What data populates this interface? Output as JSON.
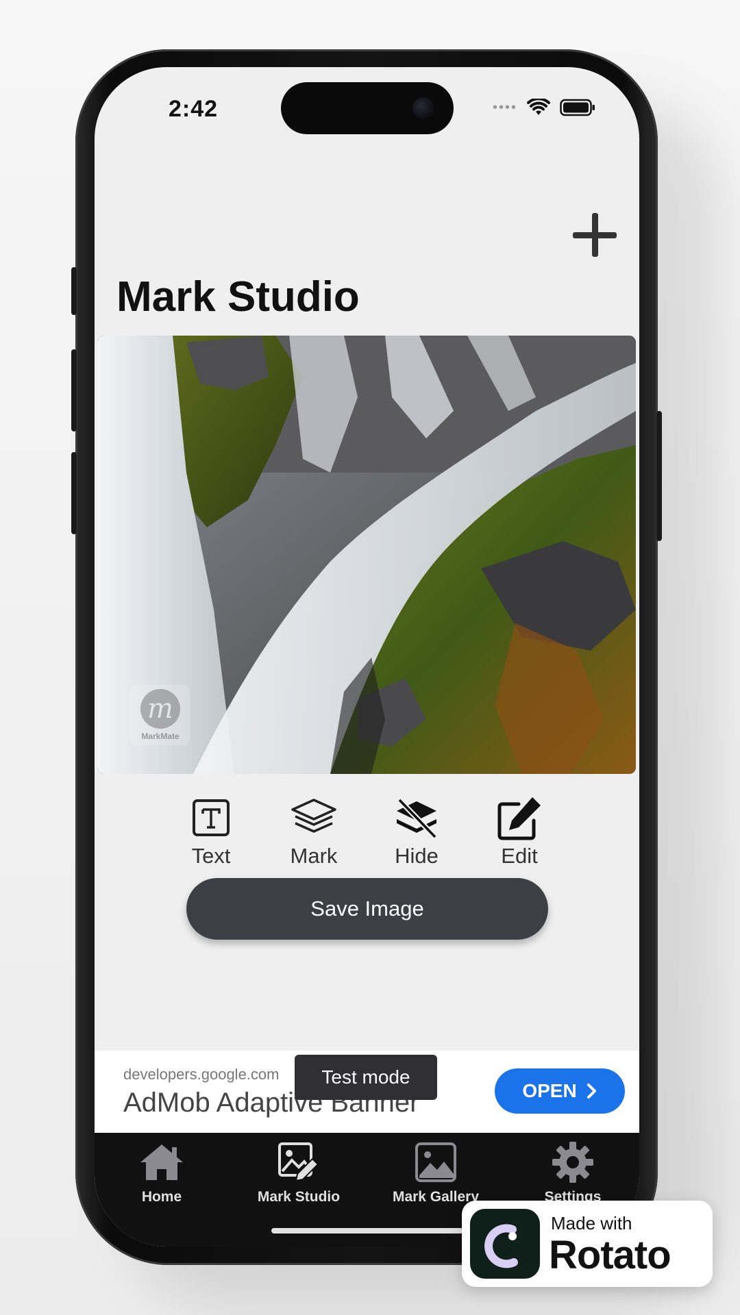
{
  "status_bar": {
    "time": "2:42"
  },
  "header": {
    "title": "Mark Studio"
  },
  "watermark": {
    "logo_letter": "m",
    "label": "MarkMate"
  },
  "tools": [
    {
      "label": "Text",
      "icon": "text-box-icon"
    },
    {
      "label": "Mark",
      "icon": "layers-icon"
    },
    {
      "label": "Hide",
      "icon": "layers-off-icon"
    },
    {
      "label": "Edit",
      "icon": "edit-icon"
    }
  ],
  "actions": {
    "save_label": "Save Image"
  },
  "ad": {
    "domain": "developers.google.com",
    "title": "AdMob Adaptive Banner",
    "badge": "Test mode",
    "cta": "OPEN"
  },
  "tabs": [
    {
      "label": "Home",
      "icon": "home-icon"
    },
    {
      "label": "Mark Studio",
      "icon": "mark-studio-icon"
    },
    {
      "label": "Mark Gallery",
      "icon": "gallery-icon"
    },
    {
      "label": "Settings",
      "icon": "gear-icon"
    }
  ],
  "badge": {
    "small": "Made with",
    "brand": "Rotato"
  },
  "colors": {
    "accent": "#1a73e8",
    "save_button": "#3e3f44",
    "tabbar": "#111111"
  }
}
